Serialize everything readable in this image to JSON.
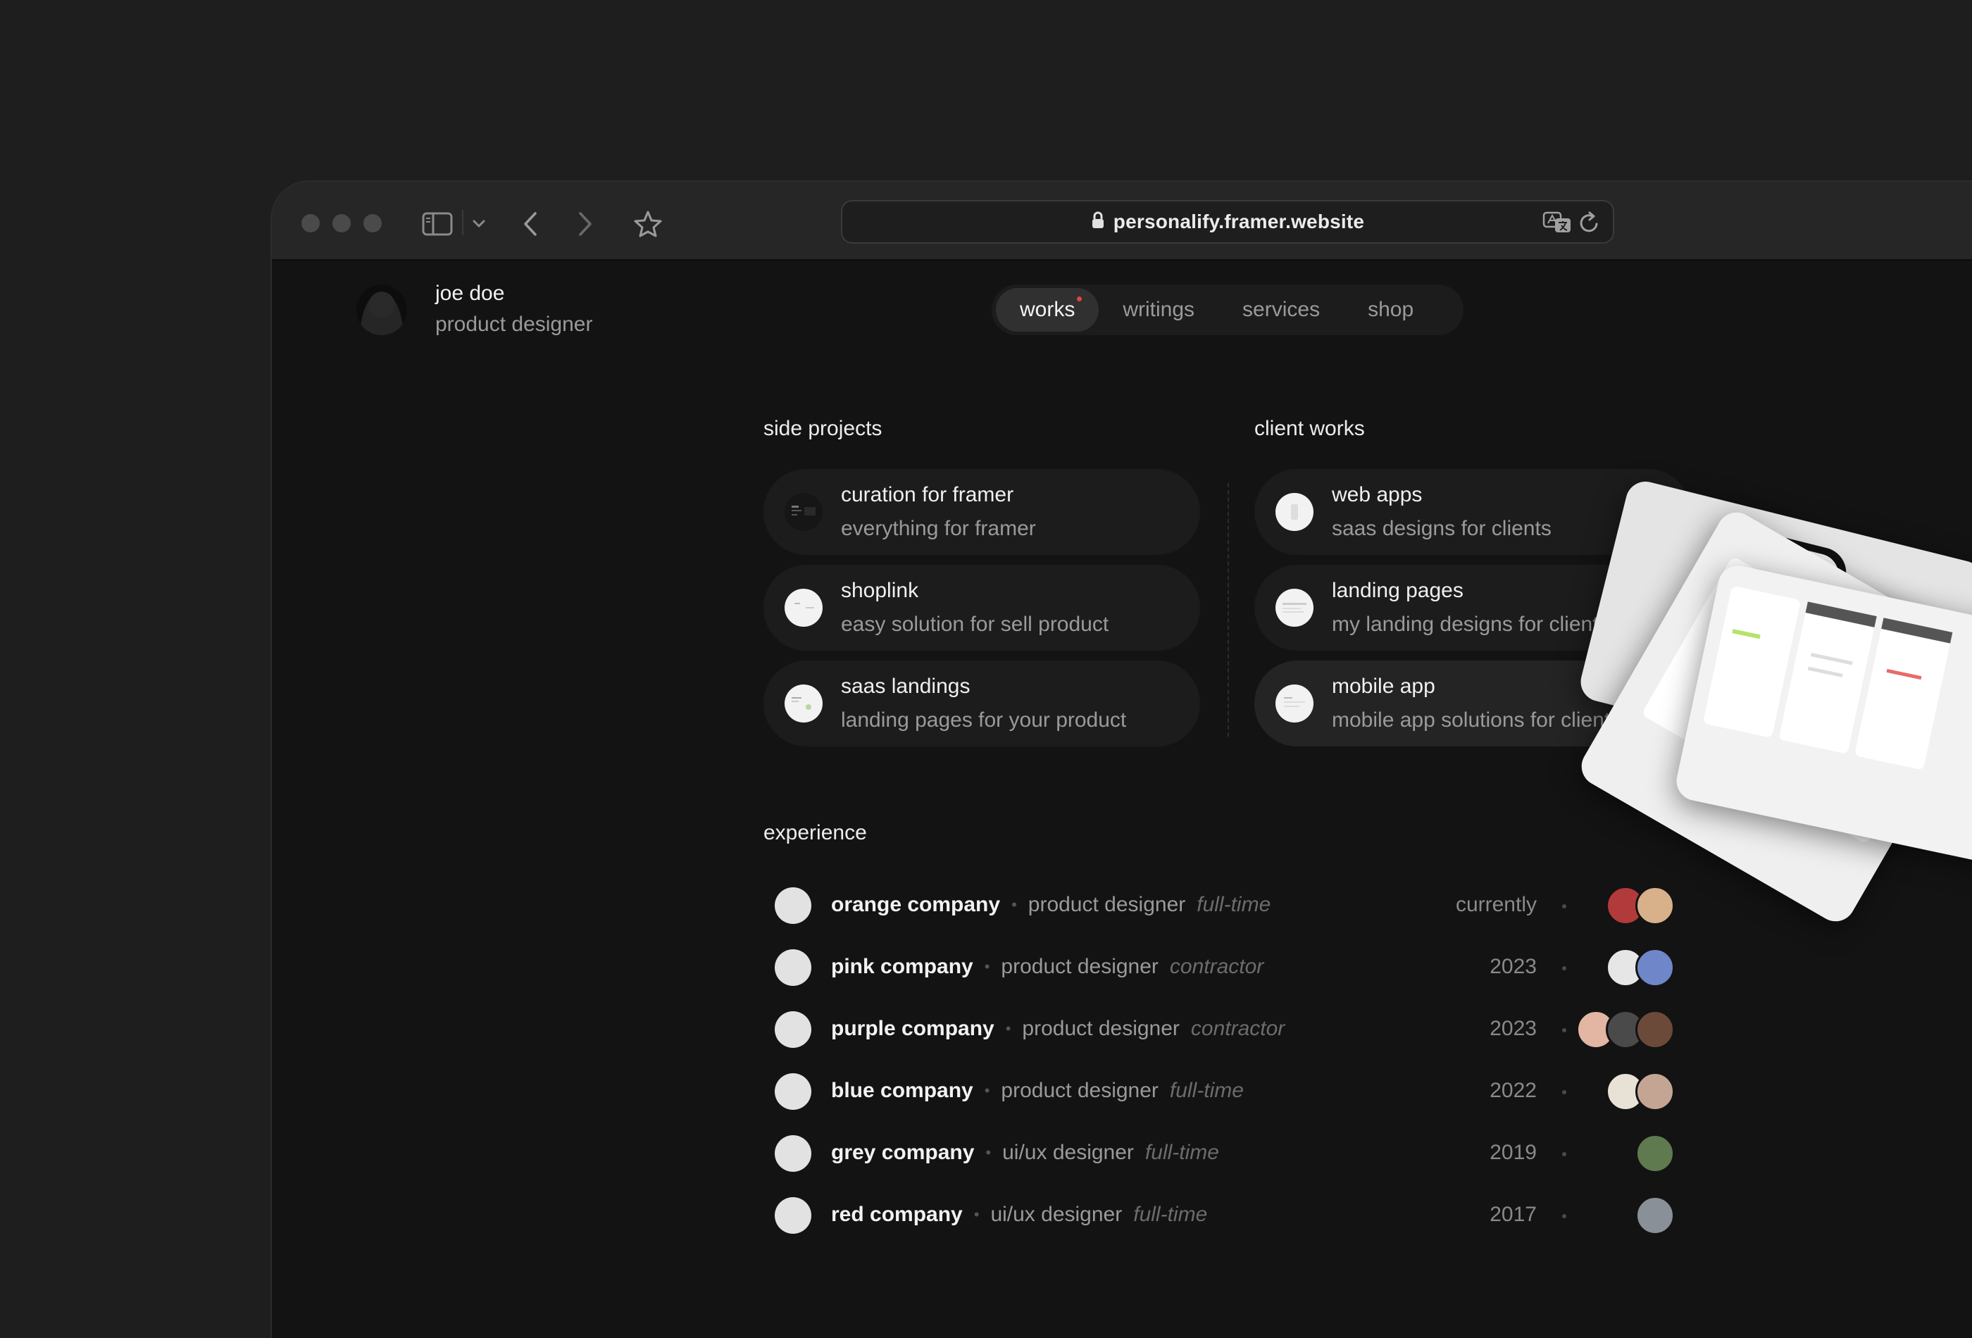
{
  "browser": {
    "url": "personalify.framer.website",
    "icons": [
      "sidebar-icon",
      "chevron-down-icon",
      "back-icon",
      "forward-icon",
      "star-icon",
      "lock-icon",
      "translate-icon",
      "reload-icon"
    ]
  },
  "profile": {
    "name": "joe doe",
    "role": "product designer"
  },
  "nav": {
    "items": [
      {
        "label": "works"
      },
      {
        "label": "writings"
      },
      {
        "label": "services"
      },
      {
        "label": "shop"
      }
    ],
    "active": "works"
  },
  "side_projects": {
    "title": "side projects",
    "items": [
      {
        "title": "curation for framer",
        "subtitle": "everything for framer"
      },
      {
        "title": "shoplink",
        "subtitle": "easy solution for sell product"
      },
      {
        "title": "saas landings",
        "subtitle": "landing pages for your product"
      }
    ]
  },
  "client_works": {
    "title": "client works",
    "items": [
      {
        "title": "web apps",
        "subtitle": "saas designs for clients"
      },
      {
        "title": "landing pages",
        "subtitle": "my landing designs for clients"
      },
      {
        "title": "mobile app",
        "subtitle": "mobile app solutions for clients"
      }
    ]
  },
  "experience": {
    "title": "experience",
    "items": [
      {
        "company": "orange company",
        "role": "product designer",
        "type": "full-time",
        "date": "currently"
      },
      {
        "company": "pink company",
        "role": "product designer",
        "type": "contractor",
        "date": "2023"
      },
      {
        "company": "purple company",
        "role": "product designer",
        "type": "contractor",
        "date": "2023"
      },
      {
        "company": "blue company",
        "role": "product designer",
        "type": "full-time",
        "date": "2022"
      },
      {
        "company": "grey company",
        "role": "ui/ux designer",
        "type": "full-time",
        "date": "2019"
      },
      {
        "company": "red company",
        "role": "ui/ux designer",
        "type": "full-time",
        "date": "2017"
      }
    ]
  },
  "colors": {
    "window": "#131313",
    "toolbar": "#262626",
    "card": "#1c1c1c",
    "accent_dot": "#e0453a"
  }
}
